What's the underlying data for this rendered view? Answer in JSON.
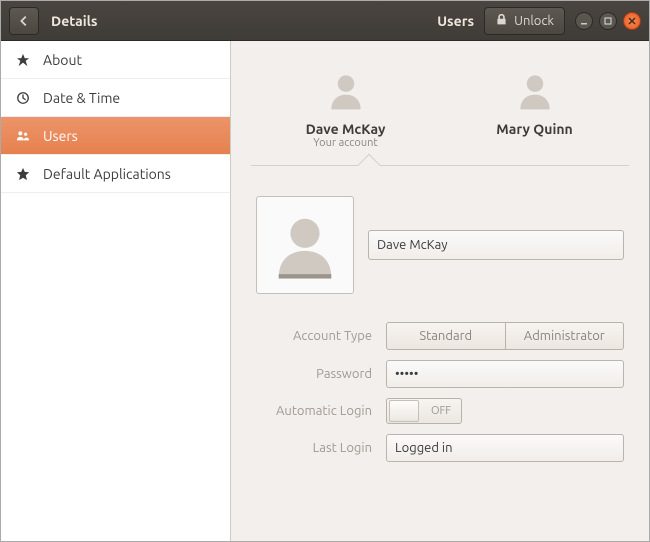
{
  "titlebar": {
    "title": "Details",
    "section": "Users",
    "unlock_label": "Unlock"
  },
  "sidebar": {
    "items": [
      {
        "label": "About"
      },
      {
        "label": "Date & Time"
      },
      {
        "label": "Users"
      },
      {
        "label": "Default Applications"
      }
    ]
  },
  "user_tabs": [
    {
      "name": "Dave McKay",
      "subtitle": "Your account",
      "selected": true
    },
    {
      "name": "Mary Quinn",
      "subtitle": "",
      "selected": false
    }
  ],
  "detail": {
    "name_value": "Dave McKay",
    "labels": {
      "account_type": "Account Type",
      "password": "Password",
      "automatic_login": "Automatic Login",
      "last_login": "Last Login"
    },
    "account_type_options": {
      "standard": "Standard",
      "administrator": "Administrator"
    },
    "password_value": "•••••",
    "automatic_login_state": "OFF",
    "last_login_value": "Logged in"
  }
}
